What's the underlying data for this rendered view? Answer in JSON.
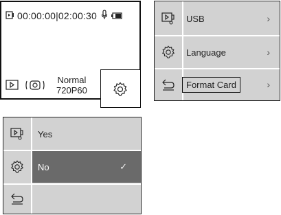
{
  "home": {
    "time": "00:00:00|02:00:30",
    "mode_line1": "Normal",
    "mode_line2": "720P60",
    "icons": [
      "video-icon",
      "microphone-icon",
      "battery-icon",
      "playback-icon",
      "stabilization-icon",
      "settings-gear-icon"
    ]
  },
  "settings_menu": {
    "items": [
      {
        "label": "USB",
        "chevron": "›",
        "icon": "video-icon"
      },
      {
        "label": "Language",
        "chevron": "›",
        "icon": "gear-icon"
      },
      {
        "label": "Format Card",
        "chevron": "›",
        "icon": "back-icon",
        "highlighted": true
      }
    ]
  },
  "confirm_menu": {
    "items": [
      {
        "label": "Yes",
        "icon": "video-icon"
      },
      {
        "label": "No",
        "icon": "gear-icon",
        "selected": true,
        "check": "✓"
      },
      {
        "label": "",
        "icon": "back-icon"
      }
    ]
  },
  "colors": {
    "menu_bg": "#d2d2d2",
    "selected_bg": "#6a6a6a",
    "border": "#111111"
  }
}
